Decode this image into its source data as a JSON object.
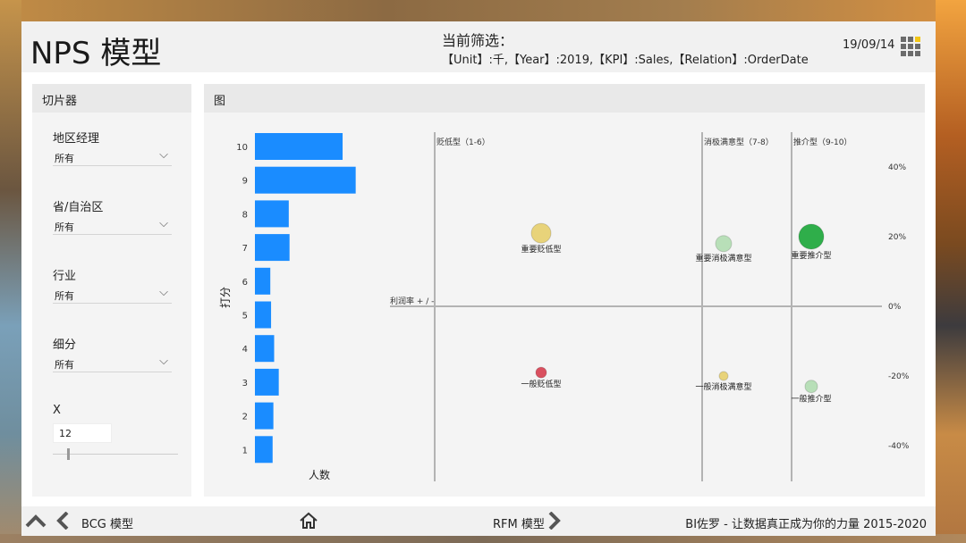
{
  "header": {
    "title": "NPS 模型",
    "filter_label": "当前筛选：",
    "filter_text": "【Unit】:千,【Year】:2019,【KPI】:Sales,【Relation】:OrderDate",
    "date": "19/09/14",
    "menu_icon": "grid-menu-icon"
  },
  "slicer": {
    "title": "切片器",
    "fields": [
      {
        "label": "地区经理",
        "value": "所有"
      },
      {
        "label": "省/自治区",
        "value": "所有"
      },
      {
        "label": "行业",
        "value": "所有"
      },
      {
        "label": "细分",
        "value": "所有"
      }
    ],
    "x_label": "X",
    "x_value": "12",
    "x_slider_fraction": 0.12
  },
  "chart_panel": {
    "title": "图"
  },
  "chart_data": [
    {
      "type": "bar",
      "orientation": "horizontal",
      "categories": [
        "10",
        "9",
        "8",
        "7",
        "6",
        "5",
        "4",
        "3",
        "2",
        "1"
      ],
      "values": [
        114,
        131,
        44,
        45,
        20,
        21,
        25,
        31,
        24,
        23
      ],
      "xlabel": "人数",
      "ylabel": "打分",
      "color": "#1a8cff"
    },
    {
      "type": "scatter",
      "x_label": "利润率 + / -",
      "ylim": [
        -40,
        40
      ],
      "yticks": [
        "40%",
        "20%",
        "0%",
        "-20%",
        "-40%"
      ],
      "segments": [
        {
          "label": "贬低型（1-6）"
        },
        {
          "label": "消极满意型（7-8）"
        },
        {
          "label": "推介型（9-10）"
        }
      ],
      "points": [
        {
          "name": "重要贬低型",
          "segment": 0,
          "y": 21,
          "size": 11,
          "color": "#e8d37a"
        },
        {
          "name": "重要消极满意型",
          "segment": 1,
          "y": 18,
          "size": 9,
          "color": "#b8dfb8"
        },
        {
          "name": "重要推介型",
          "segment": 2,
          "y": 20,
          "size": 14,
          "color": "#2fae4a"
        },
        {
          "name": "一般贬低型",
          "segment": 0,
          "y": -19,
          "size": 6,
          "color": "#d9505f"
        },
        {
          "name": "一般消极满意型",
          "segment": 1,
          "y": -20,
          "size": 5,
          "color": "#e8d37a"
        },
        {
          "name": "一般推介型",
          "segment": 2,
          "y": -23,
          "size": 7,
          "color": "#b8dfb8"
        }
      ]
    }
  ],
  "footer": {
    "bcg_label": "BCG 模型",
    "rfm_label": "RFM 模型",
    "credit": "BI佐罗 - 让数据真正成为你的力量 2015-2020"
  }
}
